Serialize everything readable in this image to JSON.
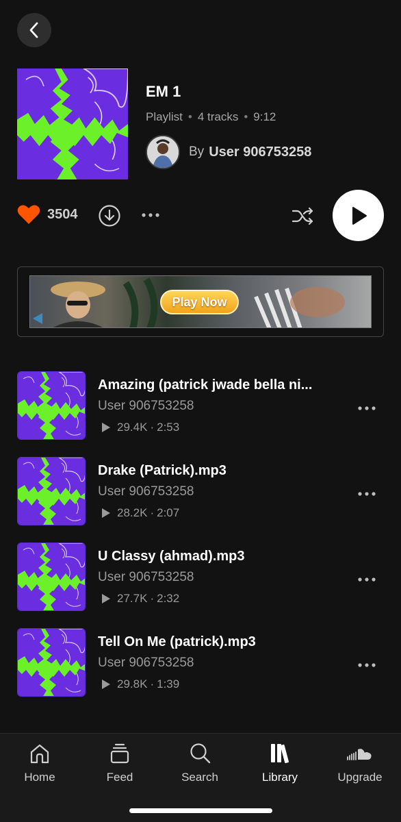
{
  "header": {
    "back_icon": "chevron-left-icon",
    "title": "EM 1",
    "type": "Playlist",
    "tracks": "4 tracks",
    "duration": "9:12",
    "by": "By",
    "owner": "User 906753258"
  },
  "actions": {
    "likes": "3504",
    "like_color": "#ff5500"
  },
  "ad": {
    "cta": "Play Now"
  },
  "tracks": [
    {
      "title": "Amazing (patrick jwade bella ni...",
      "artist": "User 906753258",
      "plays": "29.4K",
      "duration": "2:53"
    },
    {
      "title": "Drake (Patrick).mp3",
      "artist": "User 906753258",
      "plays": "28.2K",
      "duration": "2:07"
    },
    {
      "title": "U Classy (ahmad).mp3",
      "artist": "User 906753258",
      "plays": "27.7K",
      "duration": "2:32"
    },
    {
      "title": "Tell On Me (patrick).mp3",
      "artist": "User 906753258",
      "plays": "29.8K",
      "duration": "1:39"
    }
  ],
  "nav": {
    "items": [
      {
        "label": "Home",
        "icon": "home-icon"
      },
      {
        "label": "Feed",
        "icon": "feed-icon"
      },
      {
        "label": "Search",
        "icon": "search-icon"
      },
      {
        "label": "Library",
        "icon": "library-icon",
        "active": true
      },
      {
        "label": "Upgrade",
        "icon": "soundcloud-icon"
      }
    ]
  },
  "colors": {
    "background": "#121212",
    "accent": "#ff5500",
    "art_purple": "#6a2ee0",
    "art_green": "#6cf02a"
  }
}
